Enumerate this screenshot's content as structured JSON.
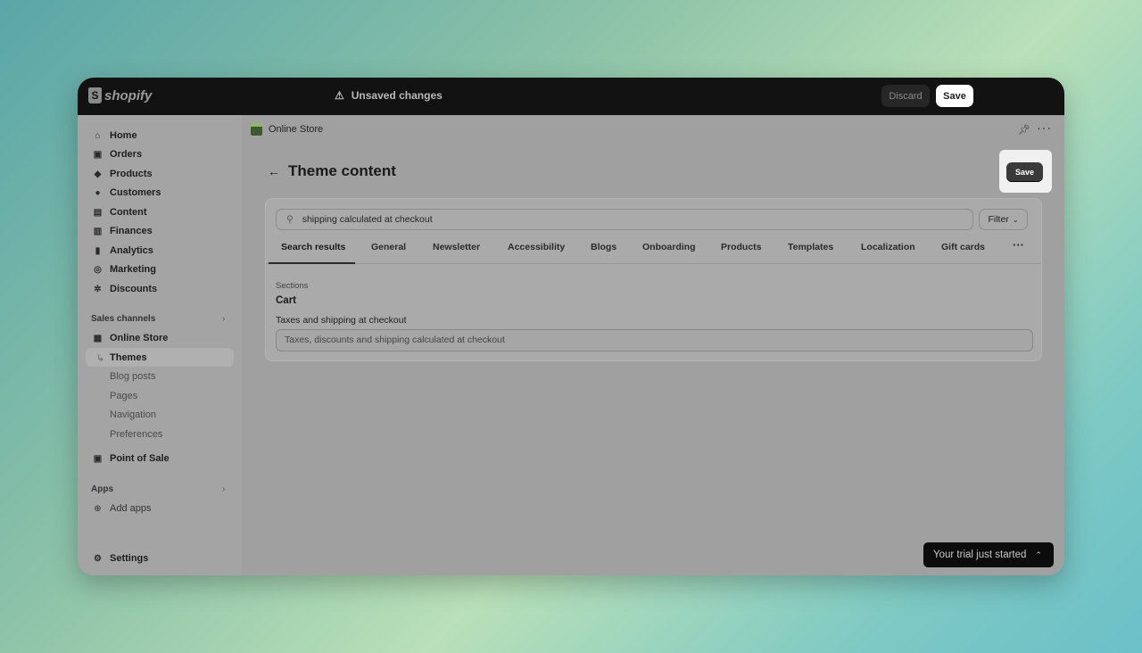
{
  "topbar": {
    "logo": "shopify",
    "status": "Unsaved changes",
    "discard": "Discard",
    "save": "Save"
  },
  "sidebar": {
    "items": [
      {
        "label": "Home",
        "icon": "home-icon"
      },
      {
        "label": "Orders",
        "icon": "inbox-icon"
      },
      {
        "label": "Products",
        "icon": "tag-icon"
      },
      {
        "label": "Customers",
        "icon": "person-icon"
      },
      {
        "label": "Content",
        "icon": "image-icon"
      },
      {
        "label": "Finances",
        "icon": "bank-icon"
      },
      {
        "label": "Analytics",
        "icon": "bar-chart-icon"
      },
      {
        "label": "Marketing",
        "icon": "target-icon"
      },
      {
        "label": "Discounts",
        "icon": "discount-icon"
      }
    ],
    "sales_channels": "Sales channels",
    "online_store": "Online Store",
    "sub_items": [
      "Themes",
      "Blog posts",
      "Pages",
      "Navigation",
      "Preferences"
    ],
    "pos": "Point of Sale",
    "apps": "Apps",
    "add_apps": "Add apps",
    "settings": "Settings"
  },
  "main": {
    "breadcrumb": "Online Store",
    "title": "Theme content",
    "save": "Save",
    "search_value": "shipping calculated at checkout",
    "filter": "Filter",
    "tabs": [
      "Search results",
      "General",
      "Newsletter",
      "Accessibility",
      "Blogs",
      "Onboarding",
      "Products",
      "Templates",
      "Localization",
      "Gift cards"
    ],
    "section_label": "Sections",
    "section_title": "Cart",
    "field_label": "Taxes and shipping at checkout",
    "field_value": "Taxes, discounts and shipping calculated at checkout"
  },
  "trial": "Your trial just started"
}
